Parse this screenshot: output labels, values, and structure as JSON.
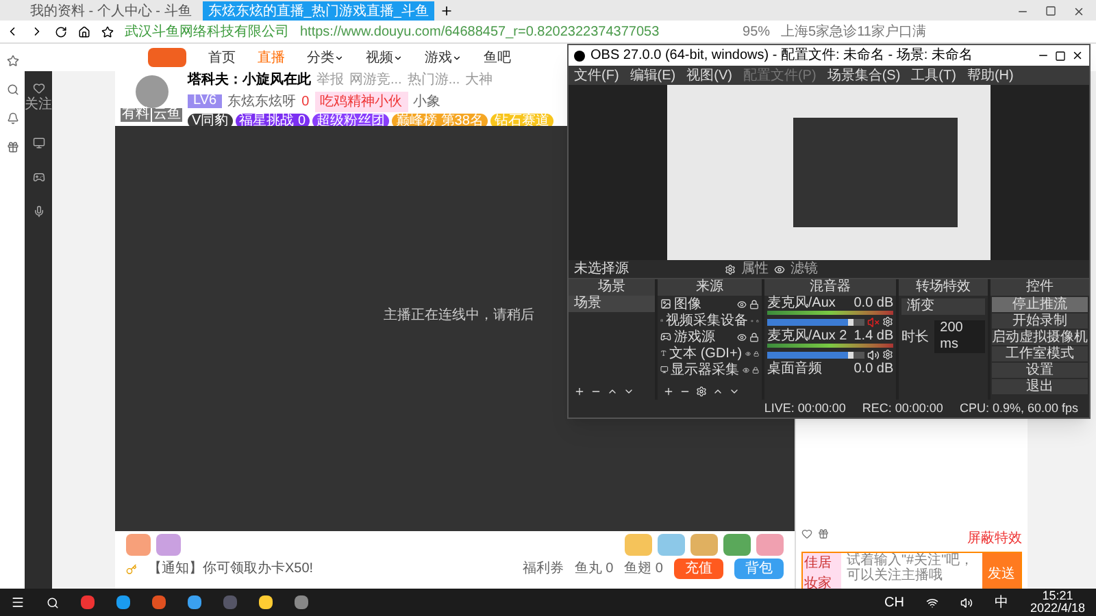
{
  "browser": {
    "tabs": [
      {
        "title": "我的资料 - 个人中心 - 斗鱼",
        "selected": false
      },
      {
        "title": "东炫东炫的直播_热门游戏直播_斗鱼",
        "selected": true
      }
    ],
    "site_identity": "武汉斗鱼网络科技有限公司",
    "url": "https://www.douyu.com/64688457_r=0.8202322374377053",
    "zoom": "95%",
    "news": "上海5家急诊11家户口满"
  },
  "sidebar": {
    "items": [
      {
        "label": "关注"
      }
    ]
  },
  "site_nav": [
    {
      "label": "首页",
      "selected": false,
      "dropdown": false
    },
    {
      "label": "直播",
      "selected": true,
      "dropdown": false
    },
    {
      "label": "分类",
      "selected": false,
      "dropdown": true
    },
    {
      "label": "视频",
      "selected": false,
      "dropdown": true
    },
    {
      "label": "游戏",
      "selected": false,
      "dropdown": true
    },
    {
      "label": "鱼吧",
      "selected": false,
      "dropdown": false
    }
  ],
  "streamer": {
    "title": "塔科夫：小旋风在此",
    "report": "举报",
    "breadcrumbs": [
      "网游竞...",
      "热门游...",
      "大神"
    ],
    "level": "LV6",
    "name": "东炫东炫呀",
    "hot": "0",
    "fan_badge": "吃鸡精神小伙",
    "follow": "小象",
    "avatar_tags": [
      "有料",
      "云鱼"
    ],
    "actions": [
      {
        "label": "V同豹",
        "color": "#3a3a3a"
      },
      {
        "label": "福星挑战 0",
        "color": "#7b2ff2"
      },
      {
        "label": "超级粉丝团",
        "color": "#8a3ffc"
      },
      {
        "label": "巅峰榜 第38名",
        "color": "#f5a623"
      },
      {
        "label": "钻石赛道",
        "color": "#f8c51c"
      }
    ]
  },
  "video": {
    "message": "主播正在连线中，请稍后"
  },
  "gift_bar": {
    "notice": "【通知】你可领取办卡X50!",
    "coupons": "福利券",
    "fish_balls": "鱼丸 0",
    "fish_fins": "鱼翅 0",
    "recharge": "充值",
    "backpack": "背包"
  },
  "chat": {
    "block_effects": "屏蔽特效",
    "placeholder": "试着输入\"#关注\"吧，可以关注主播哦",
    "promo": "佳居妆家",
    "send": "发送"
  },
  "obs": {
    "title": "OBS 27.0.0 (64-bit, windows) - 配置文件: 未命名 - 场景: 未命名",
    "menu": [
      {
        "label": "文件(F)",
        "disabled": false
      },
      {
        "label": "编辑(E)",
        "disabled": false
      },
      {
        "label": "视图(V)",
        "disabled": false
      },
      {
        "label": "配置文件(P)",
        "disabled": true
      },
      {
        "label": "场景集合(S)",
        "disabled": false
      },
      {
        "label": "工具(T)",
        "disabled": false
      },
      {
        "label": "帮助(H)",
        "disabled": false
      }
    ],
    "no_source": "未选择源",
    "properties": "属性",
    "filters": "滤镜",
    "panels": [
      "场景",
      "来源",
      "混音器",
      "转场特效",
      "控件"
    ],
    "scenes": [
      {
        "name": "场景",
        "selected": true
      }
    ],
    "sources": [
      {
        "name": "图像",
        "kind": "image"
      },
      {
        "name": "视频采集设备",
        "kind": "camera"
      },
      {
        "name": "游戏源",
        "kind": "game"
      },
      {
        "name": "文本 (GDI+)",
        "kind": "text"
      },
      {
        "name": "显示器采集",
        "kind": "monitor"
      }
    ],
    "mixer": [
      {
        "name": "麦克风/Aux",
        "reading": "0.0 dB",
        "muted": true,
        "level": 0.88
      },
      {
        "name": "麦克风/Aux 2",
        "reading": "1.4 dB",
        "muted": false,
        "level": 0.88
      },
      {
        "name": "桌面音频",
        "reading": "0.0 dB"
      }
    ],
    "transition": "渐变",
    "duration_label": "时长",
    "duration": "200 ms",
    "controls": [
      {
        "label": "停止推流",
        "selected": true
      },
      {
        "label": "开始录制",
        "selected": false
      },
      {
        "label": "启动虚拟摄像机",
        "selected": false
      },
      {
        "label": "工作室模式",
        "selected": false
      },
      {
        "label": "设置",
        "selected": false
      },
      {
        "label": "退出",
        "selected": false
      }
    ],
    "status": {
      "live": "LIVE: 00:00:00",
      "rec": "REC: 00:00:00",
      "cpu": "CPU: 0.9%, 60.00 fps"
    }
  },
  "taskbar": {
    "lang": "CH",
    "ime": "中",
    "time": "15:21",
    "date": "2022/4/18"
  }
}
